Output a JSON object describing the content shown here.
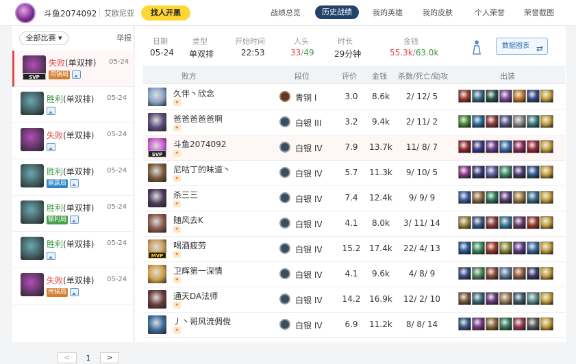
{
  "header": {
    "username": "斗鱼2074092",
    "region": "艾欧尼亚",
    "find_button": "找人开黑",
    "nav": [
      "战绩总览",
      "历史战绩",
      "我的英雄",
      "我的皮肤",
      "个人荣誉",
      "荣誉截图"
    ],
    "active_nav": "历史战绩"
  },
  "sidebar": {
    "filter_label": "全部比赛",
    "report_label": "举报",
    "matches": [
      {
        "result": "失败",
        "mode": "(单双排)",
        "date": "05-24",
        "tag": "用锅局",
        "tag_color": "#d57f32",
        "win": false,
        "selected": true,
        "svp": "SVP"
      },
      {
        "result": "胜利",
        "mode": "(单双排)",
        "date": "05-24",
        "tag": "",
        "win": true
      },
      {
        "result": "失败",
        "mode": "(单双排)",
        "date": "05-24",
        "tag": "",
        "win": false
      },
      {
        "result": "胜利",
        "mode": "(单双排)",
        "date": "05-24",
        "tag": "躺赢局",
        "tag_color": "#2f85c7",
        "win": true
      },
      {
        "result": "胜利",
        "mode": "(单双排)",
        "date": "05-24",
        "tag": "输利局",
        "tag_color": "#48a04b",
        "win": true
      },
      {
        "result": "胜利",
        "mode": "(单双排)",
        "date": "05-24",
        "tag": "",
        "win": true
      },
      {
        "result": "失败",
        "mode": "(单双排)",
        "date": "05-24",
        "tag": "用锅局",
        "tag_color": "#d57f32",
        "win": false
      }
    ],
    "pager": {
      "prev": "<",
      "page": "1",
      "next": ">"
    }
  },
  "summary": {
    "labels": [
      "日期",
      "类型",
      "开始时间",
      "人头",
      "时长",
      "金钱"
    ],
    "date": "05-24",
    "type": "单双排",
    "start_time": "22:53",
    "kills_own": "33",
    "kills_sep": "/",
    "kills_enemy": "49",
    "duration": "29分钟",
    "gold_own": "55.3k",
    "gold_sep": "/",
    "gold_enemy": "63.0k",
    "chart_button": "数据图表"
  },
  "table": {
    "headers": [
      "败方",
      "段位",
      "评价",
      "金钱",
      "杀数/死亡/助攻",
      "出装"
    ],
    "rows": [
      {
        "name": "久伴丶欣念",
        "rank": "青铜 I",
        "score": "3.0",
        "gold": "8.6k",
        "kda": "2/ 12/ 5",
        "champ": "#8aa3c7",
        "rank_type": "bronze",
        "items": [
          "#9b3d2a",
          "#3a6b8a",
          "#2a5a4a",
          "#7a4a9a",
          "#c27a2a",
          "#3a4a8a",
          "#c8a23a"
        ]
      },
      {
        "name": "爸爸爸爸爸啊",
        "rank": "白银 III",
        "score": "3.2",
        "gold": "9.4k",
        "kda": "2/ 11/ 2",
        "champ": "#5a4a7a",
        "rank_type": "silver",
        "items": [
          "#4a8a3a",
          "#2a6a9a",
          "#8a3a3a",
          "#5a5a8a",
          "#8a8a8a",
          "#3a7a7a",
          "#c8a23a"
        ]
      },
      {
        "name": "斗鱼2074092",
        "rank": "白银 IV",
        "score": "7.9",
        "gold": "13.7k",
        "kda": "11/ 8/ 7",
        "champ": "#c85ad0",
        "rank_type": "silver",
        "me": true,
        "badge": "SVP",
        "items": [
          "#9a2a2a",
          "#3a3a8a",
          "#6a3a8a",
          "#3a6aaa",
          "#8a2a5a",
          "#9a2a3a",
          "#c8a23a"
        ]
      },
      {
        "name": "尼咕丁的味道丶",
        "rank": "白银 IV",
        "score": "5.7",
        "gold": "11.3k",
        "kda": "9/ 10/ 5",
        "champ": "#7a5a3a",
        "rank_type": "silver",
        "items": [
          "#8a3a8a",
          "#3a3a7a",
          "#5a5a9a",
          "#3a8a6a",
          "#4a3a6a",
          "#2a5a8a",
          "#c8a23a"
        ]
      },
      {
        "name": "杀三三",
        "rank": "白银 IV",
        "score": "7.4",
        "gold": "12.4k",
        "kda": "9/ 9/ 9",
        "champ": "#4a3a5a",
        "rank_type": "silver",
        "items": [
          "#3a5a9a",
          "#8a6a3a",
          "#2a7a5a",
          "#5a3a7a",
          "#9a7a3a",
          "#3a6a8a",
          "#c8a23a"
        ]
      },
      {
        "name": "随风去K",
        "rank": "白银 IV",
        "score": "4.1",
        "gold": "8.0k",
        "kda": "3/ 11/ 14",
        "champ": "#8a5a4a",
        "rank_type": "silver",
        "items": [
          "#9a8a3a",
          "#3a5a8a",
          "#8a3a3a",
          "#3a7a9a",
          "#6a3a6a",
          "#9a3a2a",
          "#c8a23a"
        ]
      },
      {
        "name": "喝酒疲劳",
        "rank": "白银 IV",
        "score": "15.2",
        "gold": "17.4k",
        "kda": "22/ 4/ 13",
        "champ": "#c89a5a",
        "rank_type": "silver",
        "badge": "MVP",
        "highlight": true,
        "items": [
          "#2a5a9a",
          "#3a8a5a",
          "#9a3a2a",
          "#8a8a3a",
          "#5a3a8a",
          "#3a6a9a",
          "#c8a23a"
        ]
      },
      {
        "name": "卫辉第一深情",
        "rank": "白银 IV",
        "score": "4.1",
        "gold": "9.6k",
        "kda": "4/ 8/ 9",
        "champ": "#d0a04a",
        "rank_type": "silver",
        "items": [
          "#3a4a8a",
          "#4a8a5a",
          "#8a4a3a",
          "#5a7a9a",
          "#9a5a3a",
          "#3a3a6a",
          "#c8a23a"
        ]
      },
      {
        "name": "通天DA法师",
        "rank": "白银 IV",
        "score": "14.2",
        "gold": "16.9k",
        "kda": "12/ 2/ 10",
        "champ": "#6a3a3a",
        "rank_type": "silver",
        "items": [
          "#7a5a3a",
          "#3a6a7a",
          "#6a3a7a",
          "#9a7a5a",
          "#3a5a6a",
          "#5a8a8a",
          "#c8a23a"
        ]
      },
      {
        "name": "丿丶哥风流倜傥",
        "rank": "白银 IV",
        "score": "6.9",
        "gold": "11.2k",
        "kda": "8/ 8/ 14",
        "champ": "#3a6a9a",
        "rank_type": "silver",
        "items": [
          "#3a5a8a",
          "#7a3a8a",
          "#8a6a3a",
          "#3a7a5a",
          "#9a3a4a",
          "#5a5a5a",
          "#c8a23a"
        ]
      }
    ]
  },
  "colors": {
    "accent_nav": "#23436b",
    "win": "#3a9a3f",
    "loss": "#e14a4a",
    "find_button": "#ffd733"
  }
}
